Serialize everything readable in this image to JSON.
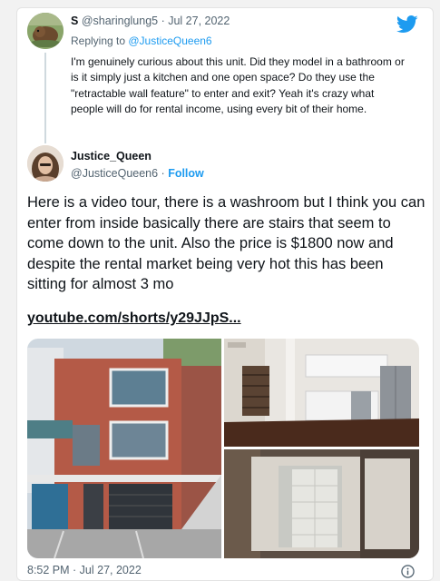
{
  "reply": {
    "display_name": "S",
    "handle_date": "@sharinglung5 · Jul 27, 2022",
    "replying_prefix": "Replying to ",
    "replying_to": "@JusticeQueen6",
    "text": "I'm genuinely curious about this unit. Did they model in a bathroom or is it simply just a kitchen and one open space? Do they use the \"retractable wall feature\" to enter and exit? Yeah it's crazy what people will do for rental income, using every bit of their home."
  },
  "tweet": {
    "display_name": "Justice_Queen",
    "handle": "@JusticeQueen6",
    "separator": " · ",
    "follow_label": "Follow",
    "text": "Here is a video tour, there is a washroom but I think you can enter from inside basically there are stairs that seem to come down to the unit. Also the price is $1800 now and despite the rental market being very hot this has been sitting for almost 3 mo",
    "link_text": "youtube.com/shorts/y29JJpS...",
    "timestamp": "8:52 PM · Jul 27, 2022"
  },
  "icons": {
    "brand": "twitter-bird-icon",
    "info": "info-icon"
  },
  "colors": {
    "accent": "#1d9bf0",
    "muted": "#536471",
    "text": "#0f1419",
    "thread_line": "#cfd9de"
  }
}
